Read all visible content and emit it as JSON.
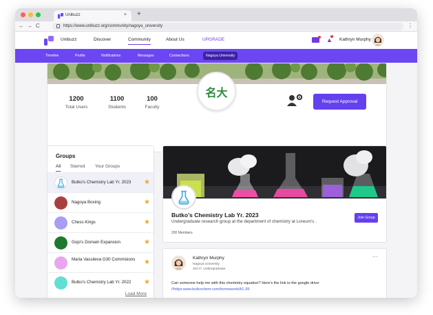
{
  "browser": {
    "tab_title": "Unibuzz",
    "tab_close": "×",
    "new_tab": "+",
    "url": "https://www.unibuzz.org/community/nagoya_university",
    "back": "←",
    "forward": "→",
    "reload": "C",
    "menu": "⋮"
  },
  "nav": {
    "brand": "Unibuzz",
    "links": [
      "Discover",
      "Community",
      "About Us"
    ],
    "upgrade": "UPGRADE",
    "user_name": "Kathryn Murphy"
  },
  "subnav": {
    "items": [
      "Timeline",
      "Profile",
      "Notifications",
      "Messages",
      "Connections"
    ],
    "active": "Nagoya University"
  },
  "community": {
    "emblem_text": "名大",
    "stats": [
      {
        "value": "1200",
        "label": "Total Users"
      },
      {
        "value": "1100",
        "label": "Students"
      },
      {
        "value": "100",
        "label": "Faculty"
      }
    ],
    "request_button": "Request Approval"
  },
  "groups": {
    "title": "Groups",
    "tabs": [
      "All",
      "Starred",
      "Your Groups"
    ],
    "items": [
      {
        "name": "Butko's Chemistry Lab Yr. 2023",
        "color": "#ffffff"
      },
      {
        "name": "Nagoya Boxing",
        "color": "#a94040"
      },
      {
        "name": "Chess Kings",
        "color": "#a99cf3"
      },
      {
        "name": "Gojo's Domain Expansion",
        "color": "#1e7a2e"
      },
      {
        "name": "Maria Vassileva G30 Commisions",
        "color": "#e9a6ef"
      },
      {
        "name": "Butko's Chemistry Lab Yr. 2022",
        "color": "#5fe0d2"
      }
    ],
    "star": "★",
    "load_more": "Load More"
  },
  "group_card": {
    "title": "Butko's Chemistry Lab Yr. 2023",
    "description": "Undergraduate research group at the department of chemistry at Loreum's .",
    "members": "200 Members",
    "join_button": "Join Group"
  },
  "post": {
    "author": "Kathryn Murphy",
    "university": "Nagoya University",
    "year": "3rd Yr. Undergraduate",
    "more": "···",
    "text": "Can someone help me with this chemistry equation? Here's the link to the google drive:",
    "link": "//https:www.butkochem.com/homework/A1-35"
  },
  "colors": {
    "accent": "#6b46f2",
    "button": "#6440ef",
    "star": "#f3a623"
  }
}
